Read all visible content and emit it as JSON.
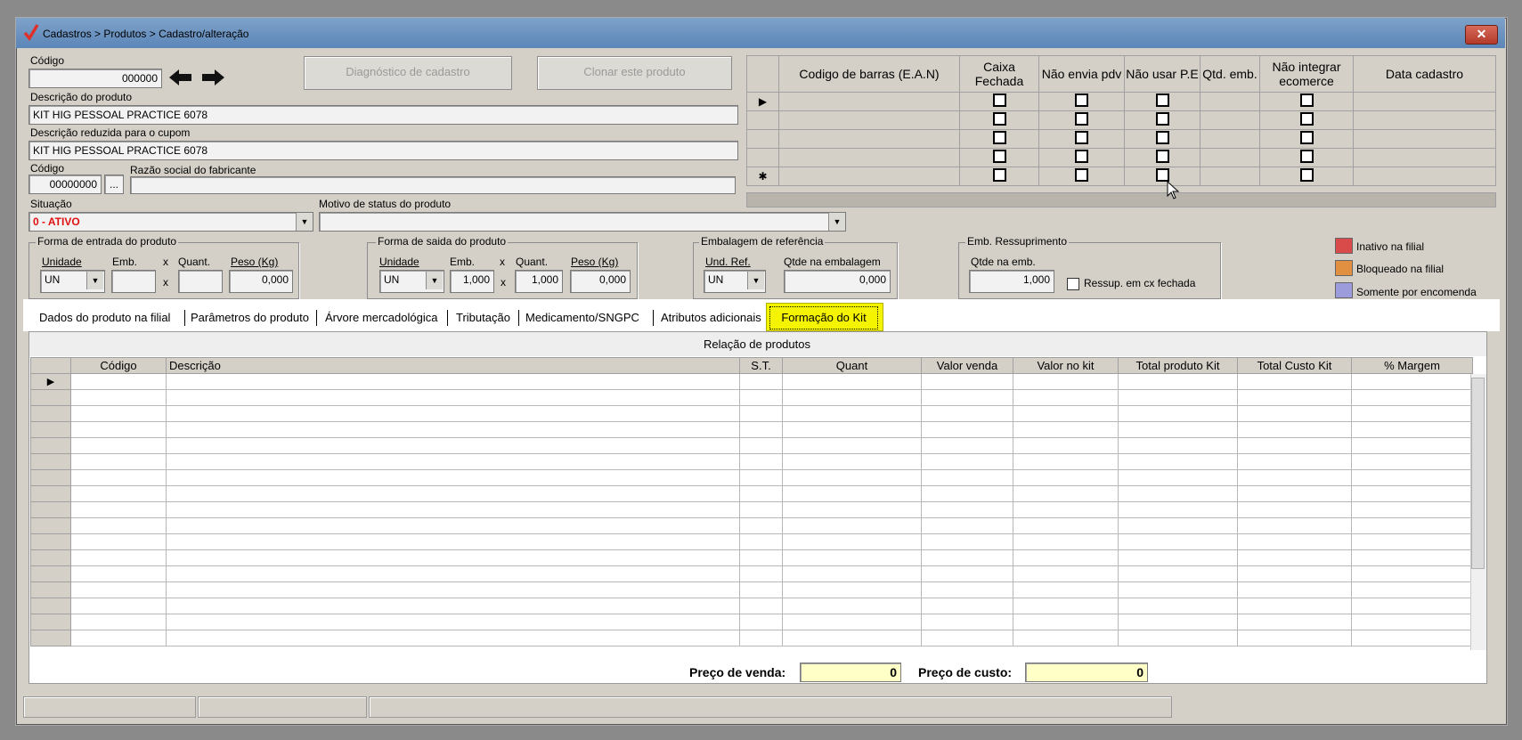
{
  "window": {
    "title": "Cadastros > Produtos > Cadastro/alteração",
    "close_label": "✕"
  },
  "form": {
    "codigo_label": "Código",
    "codigo_value": "000000",
    "descricao_label": "Descrição  do produto",
    "descricao_value": "KIT HIG PESSOAL PRACTICE 6078",
    "descricao_reduzida_label": "Descrição reduzida para o cupom",
    "descricao_reduzida_value": "KIT HIG PESSOAL PRACTICE 6078",
    "fabricante_codigo_label": "Código",
    "fabricante_codigo_value": "00000000",
    "fabricante_lookup_label": "...",
    "razao_social_label": "Razão social do fabricante",
    "razao_social_value": "",
    "situacao_label": "Situação",
    "situacao_value": "0 - ATIVO",
    "motivo_label": "Motivo de status do produto",
    "motivo_value": "",
    "diagnostico_button": "Diagnóstico de cadastro",
    "clonar_button": "Clonar este produto"
  },
  "barcode_grid": {
    "headers": [
      "Codigo de barras (E.A.N)",
      "Caixa Fechada",
      "Não envia pdv",
      "Não usar P.E",
      "Qtd. emb.",
      "Não integrar ecomerce",
      "Data cadastro"
    ],
    "row_count": 5,
    "current_marker": "▶",
    "new_marker": "✱"
  },
  "entrada": {
    "title": "Forma de entrada do produto",
    "unidade_label": "Unidade",
    "emb_label": "Emb.",
    "x1": "x",
    "quant_label": "Quant.",
    "peso_label": "Peso (Kg)",
    "unidade_value": "UN",
    "x2": "x",
    "peso_value": "0,000"
  },
  "saida": {
    "title": "Forma de saida do produto",
    "unidade_label": "Unidade",
    "emb_label": "Emb.",
    "x1": "x",
    "quant_label": "Quant.",
    "peso_label": "Peso (Kg)",
    "unidade_value": "UN",
    "emb_value": "1,000",
    "x2": "x",
    "quant_value": "1,000",
    "peso_value": "0,000"
  },
  "embalagem": {
    "title": "Embalagem de referência",
    "und_label": "Und. Ref.",
    "qtde_label": "Qtde na embalagem",
    "und_value": "UN",
    "qtde_value": "0,000"
  },
  "ressuprimento": {
    "title": "Emb. Ressuprimento",
    "qtde_label": "Qtde na emb.",
    "qtde_value": "1,000",
    "checkbox_label": "Ressup. em cx fechada"
  },
  "legend": [
    {
      "label": "Inativo na filial",
      "color": "#d94a4a"
    },
    {
      "label": "Bloqueado na filial",
      "color": "#e09040"
    },
    {
      "label": "Somente por encomenda",
      "color": "#9c9cdc"
    }
  ],
  "tabs": [
    "Dados do produto na filial",
    "Parâmetros do produto",
    "Árvore mercadológica",
    "Tributação",
    "Medicamento/SNGPC",
    "Atributos adicionais",
    "Formação do Kit"
  ],
  "active_tab": "Formação do Kit",
  "highlight_color": "#f4f400",
  "kit_grid": {
    "caption": "Relação de produtos",
    "headers": [
      "Código",
      "Descrição",
      "S.T.",
      "Quant",
      "Valor venda",
      "Valor no kit",
      "Total produto Kit",
      "Total Custo Kit",
      "% Margem"
    ],
    "current_marker": "▶",
    "row_count": 17
  },
  "totals": {
    "preco_venda_label": "Preço de venda:",
    "preco_venda_value": "0",
    "preco_custo_label": "Preço de custo:",
    "preco_custo_value": "0"
  }
}
